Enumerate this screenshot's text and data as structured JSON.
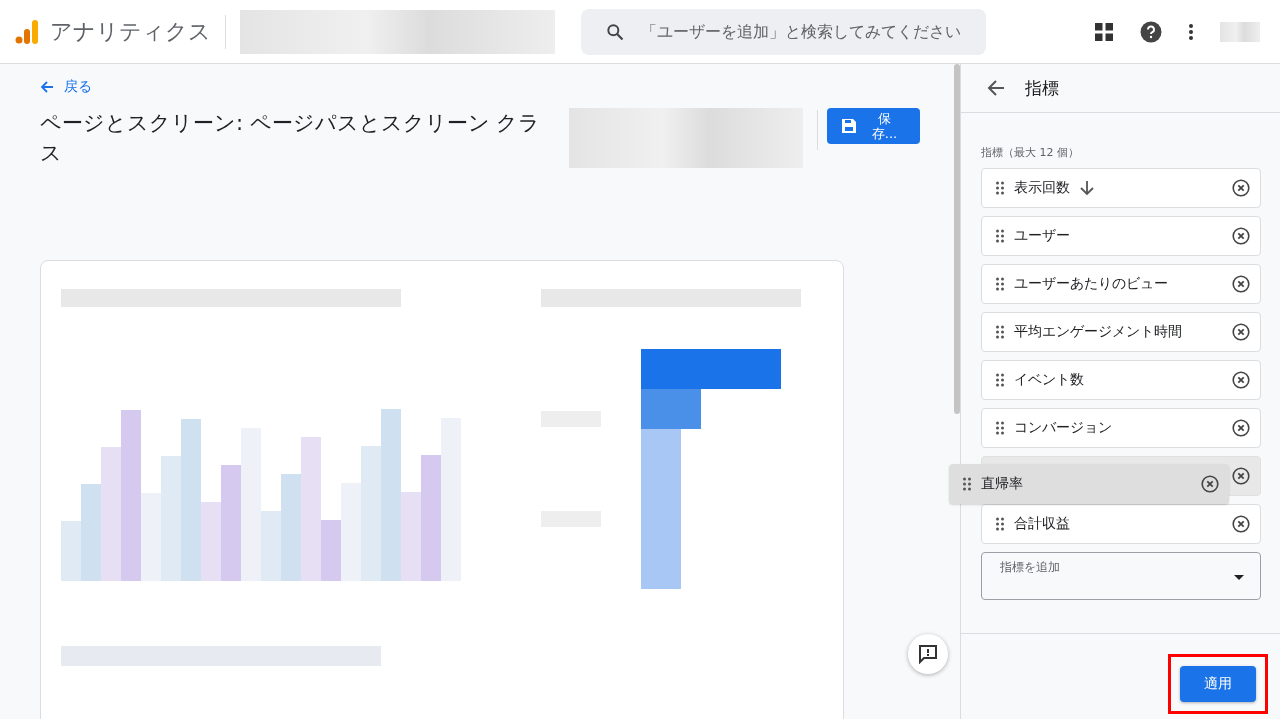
{
  "app": {
    "name": "アナリティクス"
  },
  "search": {
    "placeholder": "「ユーザーを追加」と検索してみてください"
  },
  "back_link": "戻る",
  "page_title": "ページとスクリーン: ページパスとスクリーン クラス",
  "save_button": "保存...",
  "panel": {
    "title": "指標",
    "list_label": "指標（最大 12 個）",
    "metrics": [
      {
        "kind": "metric",
        "label": "表示回数",
        "sorted": true
      },
      {
        "kind": "metric",
        "label": "ユーザー",
        "sorted": false
      },
      {
        "kind": "metric",
        "label": "ユーザーあたりのビュー",
        "sorted": false
      },
      {
        "kind": "metric",
        "label": "平均エンゲージメント時間",
        "sorted": false
      },
      {
        "kind": "metric",
        "label": "イベント数",
        "sorted": false
      },
      {
        "kind": "metric",
        "label": "コンバージョン",
        "sorted": false
      },
      {
        "kind": "slot"
      },
      {
        "kind": "metric",
        "label": "合計収益",
        "sorted": false
      }
    ],
    "dragging": {
      "label": "直帰率"
    },
    "add_field": {
      "placeholder": "指標を追加"
    },
    "apply_button": {
      "label": "適用",
      "highlighted": true
    }
  }
}
